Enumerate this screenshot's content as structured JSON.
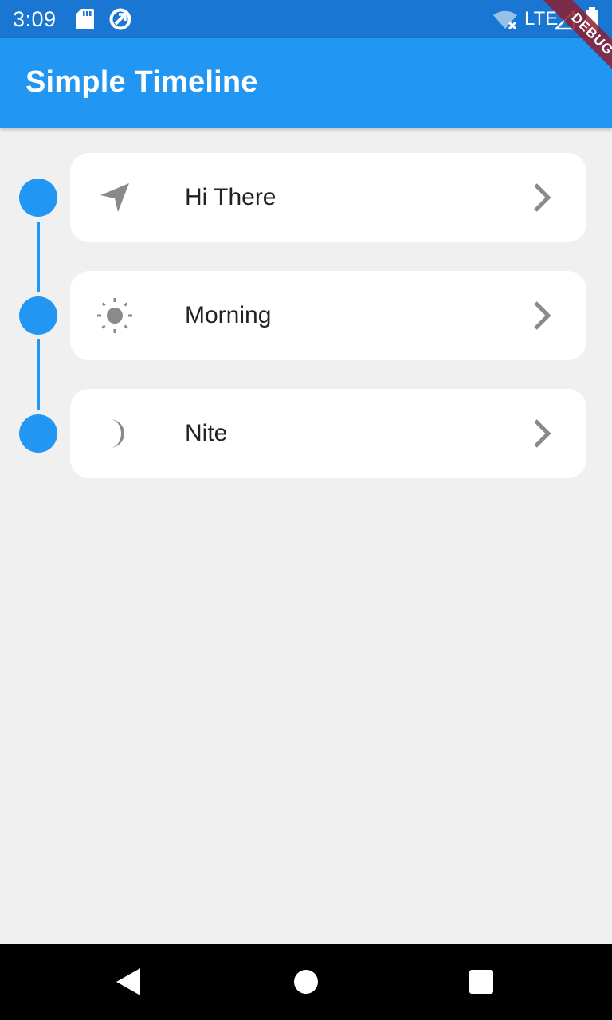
{
  "status_bar": {
    "time": "3:09",
    "network": "LTE",
    "icons": [
      "sd-card-icon",
      "sync-icon",
      "wifi-off-icon",
      "signal-icon",
      "battery-icon"
    ]
  },
  "app_bar": {
    "title": "Simple Timeline",
    "debug_banner": "DEBUG"
  },
  "timeline": {
    "items": [
      {
        "label": "Hi There",
        "icon": "navigation-icon"
      },
      {
        "label": "Morning",
        "icon": "sun-icon"
      },
      {
        "label": "Nite",
        "icon": "moon-icon"
      }
    ]
  },
  "colors": {
    "primary": "#2196f3",
    "status_bar": "#1976d2",
    "background": "#f0f0f0",
    "icon_grey": "#8a8a8a"
  },
  "nav_bar": {
    "buttons": [
      "back-icon",
      "home-icon",
      "recents-icon"
    ]
  }
}
